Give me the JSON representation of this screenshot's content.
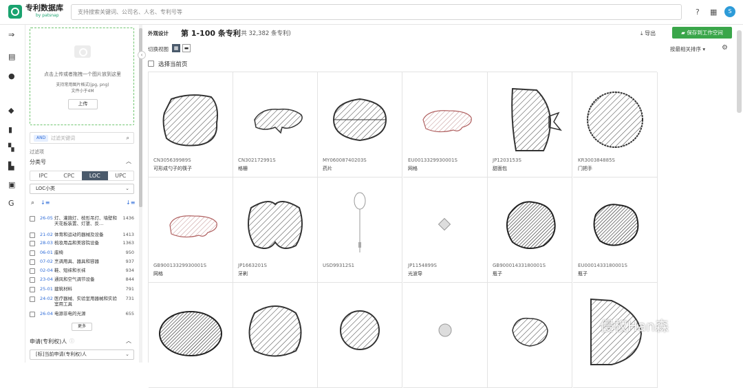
{
  "app": {
    "brand": "专利数据库",
    "brand_sub": "by patsnap",
    "avatar": "S"
  },
  "search": {
    "placeholder": "支持搜索关键词、公司名、人名、专利号等"
  },
  "upload": {
    "line1": "点击上传或者拖拽一个图片放到这里",
    "line2": "支持常用图片格式(jpg, png)",
    "line3": "文件小于4M",
    "button": "上传"
  },
  "keyword": {
    "and": "AND",
    "placeholder": "过滤关键词"
  },
  "filter": {
    "label": "过滤项",
    "classification": "分类号",
    "segments": [
      "IPC",
      "CPC",
      "LOC",
      "UPC"
    ],
    "active_segment": "LOC",
    "loc_select": "LOC小类",
    "loc_items": [
      {
        "code": "26-05",
        "name": "灯、灌施灯、枝形吊灯、墙壁和天花板装置、灯罩、反…",
        "count": "1436"
      },
      {
        "code": "21-02",
        "name": "体育和运动的器械及设备",
        "count": "1413"
      },
      {
        "code": "28-03",
        "name": "梳妆用品和美容院设备",
        "count": "1363"
      },
      {
        "code": "06-01",
        "name": "座椅",
        "count": "950"
      },
      {
        "code": "07-02",
        "name": "烹调用具、器具和容器",
        "count": "937"
      },
      {
        "code": "02-04",
        "name": "鞋、短袜和长袜",
        "count": "934"
      },
      {
        "code": "23-04",
        "name": "通风和空气调节设备",
        "count": "844"
      },
      {
        "code": "25-01",
        "name": "建筑材料",
        "count": "791"
      },
      {
        "code": "24-02",
        "name": "医疗器械、实验室用器械和实验室用工具",
        "count": "731"
      },
      {
        "code": "26-04",
        "name": "电源非电的光源",
        "count": "655"
      }
    ],
    "more": "更多",
    "applicant_label": "申请(专利权)人",
    "applicant_select": "[标]当前申请(专利权)人"
  },
  "header": {
    "tag": "外观设计",
    "title": "第 1-100 条专利",
    "total": "(共 32,382 条专利)",
    "export": "导出",
    "save": "保存到工作空间",
    "view_label": "切换视图",
    "sort": "按最相关排序",
    "select_page": "选择当前页"
  },
  "cards": [
    {
      "pn": "CN305639989S",
      "name": "可形成勺子的筷子"
    },
    {
      "pn": "CN302172991S",
      "name": "格栅"
    },
    {
      "pn": "MY06008740203S",
      "name": "药片"
    },
    {
      "pn": "EU0013329930001S",
      "name": "网格"
    },
    {
      "pn": "JP1203153S",
      "name": "甜面包"
    },
    {
      "pn": "KR300384885S",
      "name": "门把手"
    },
    {
      "pn": "GB90013329930001S",
      "name": "网格"
    },
    {
      "pn": "JP1663201S",
      "name": "牙刷"
    },
    {
      "pn": "USD99312S1",
      "name": ""
    },
    {
      "pn": "JP1154899S",
      "name": "光波导"
    },
    {
      "pn": "GB90001433180001S",
      "name": "瓶子"
    },
    {
      "pn": "EU0001433180001S",
      "name": "瓶子"
    },
    {
      "pn": "",
      "name": ""
    },
    {
      "pn": "",
      "name": ""
    },
    {
      "pn": "",
      "name": ""
    },
    {
      "pn": "",
      "name": ""
    },
    {
      "pn": "",
      "name": ""
    },
    {
      "pn": "",
      "name": ""
    }
  ],
  "watermark": "侵权Han森",
  "colors": {
    "accent": "#1aa36f",
    "save": "#3aa64a",
    "segment_active": "#4a5a6b",
    "link": "#2d6bd8"
  }
}
